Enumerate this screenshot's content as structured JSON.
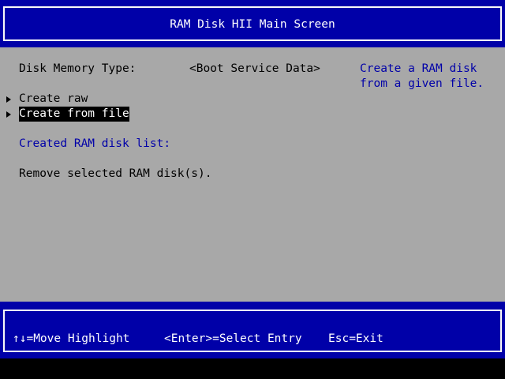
{
  "title": "RAM Disk HII Main Screen",
  "form": {
    "disk_memory_type_label": "Disk Memory Type:",
    "disk_memory_type_value": "<Boot Service Data>",
    "help_line1": "Create a RAM disk",
    "help_line2": "from a given file.",
    "create_raw_label": "Create raw",
    "create_from_file_label": "Create from file",
    "created_list_label": "Created RAM disk list:",
    "remove_label": "Remove selected RAM disk(s)."
  },
  "footer": {
    "move_hint": "↑↓=Move Highlight",
    "enter_hint": "<Enter>=Select Entry",
    "esc_hint": "Esc=Exit"
  },
  "colors": {
    "title_background": "#0000a8",
    "body_background": "#a8a8a8",
    "highlight_text": "#0000a8",
    "selection_background": "#000000"
  },
  "icons": {
    "submenu_marker": "right-triangle-icon"
  }
}
